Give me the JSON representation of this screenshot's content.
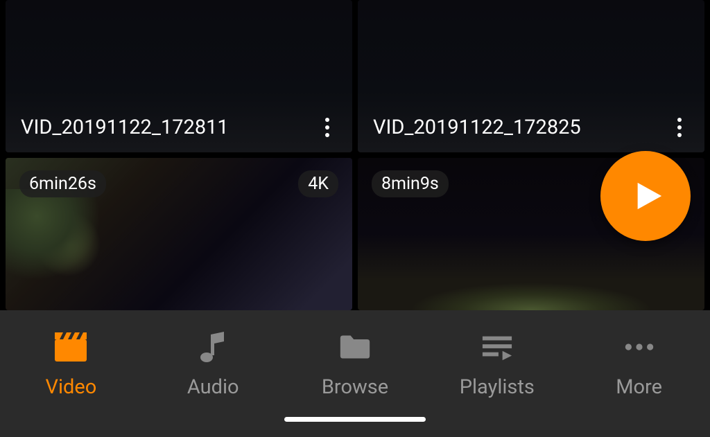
{
  "videos": {
    "row1": [
      {
        "title": "VID_20191122_172811"
      },
      {
        "title": "VID_20191122_172825"
      }
    ],
    "row2": [
      {
        "duration": "6min26s",
        "resolution": "4K"
      },
      {
        "duration": "8min9s",
        "resolution": ""
      }
    ]
  },
  "nav": {
    "video": "Video",
    "audio": "Audio",
    "browse": "Browse",
    "playlists": "Playlists",
    "more": "More"
  },
  "colors": {
    "accent": "#ff8800"
  }
}
